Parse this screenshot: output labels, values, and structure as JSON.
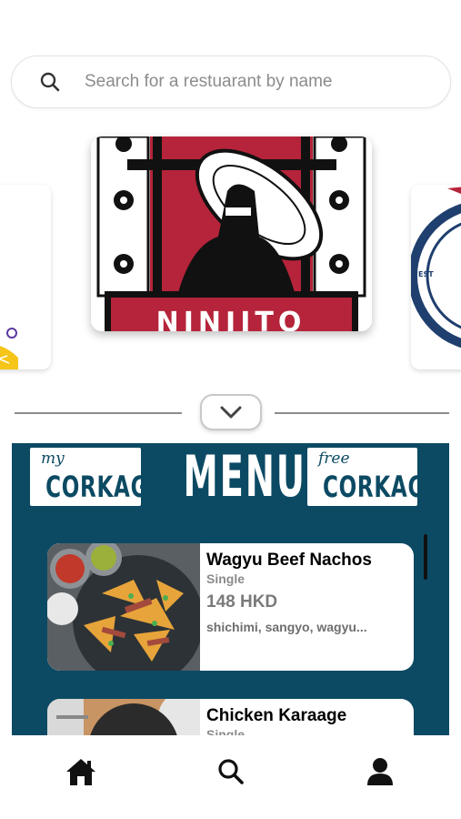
{
  "search": {
    "placeholder": "Search for a restuarant by name",
    "icon": "search-icon"
  },
  "carousel": {
    "cards": [
      {
        "id": "left",
        "accent": "#5b3aa0"
      },
      {
        "id": "main",
        "logo_text": "NINJITO",
        "accent": "#b5243a"
      },
      {
        "id": "right",
        "logo_text": "EST",
        "accent": "#1f3f6e"
      }
    ]
  },
  "divider": {
    "toggle_icon": "chevron-down-icon"
  },
  "menu": {
    "title": "MENU",
    "badge_left": {
      "script": "my",
      "big": "CORKAGE"
    },
    "badge_right": {
      "script": "free",
      "big": "CORKAGE"
    },
    "background": "#0c4a63",
    "items": [
      {
        "name": "Wagyu Beef Nachos",
        "size": "Single",
        "price": "148 HKD",
        "description": "shichimi, sangyo, wagyu..."
      },
      {
        "name": "Chicken Karaage",
        "size": "Single"
      }
    ]
  },
  "nav": [
    {
      "name": "home",
      "icon": "home-icon"
    },
    {
      "name": "search",
      "icon": "search-icon"
    },
    {
      "name": "profile",
      "icon": "user-icon"
    }
  ]
}
